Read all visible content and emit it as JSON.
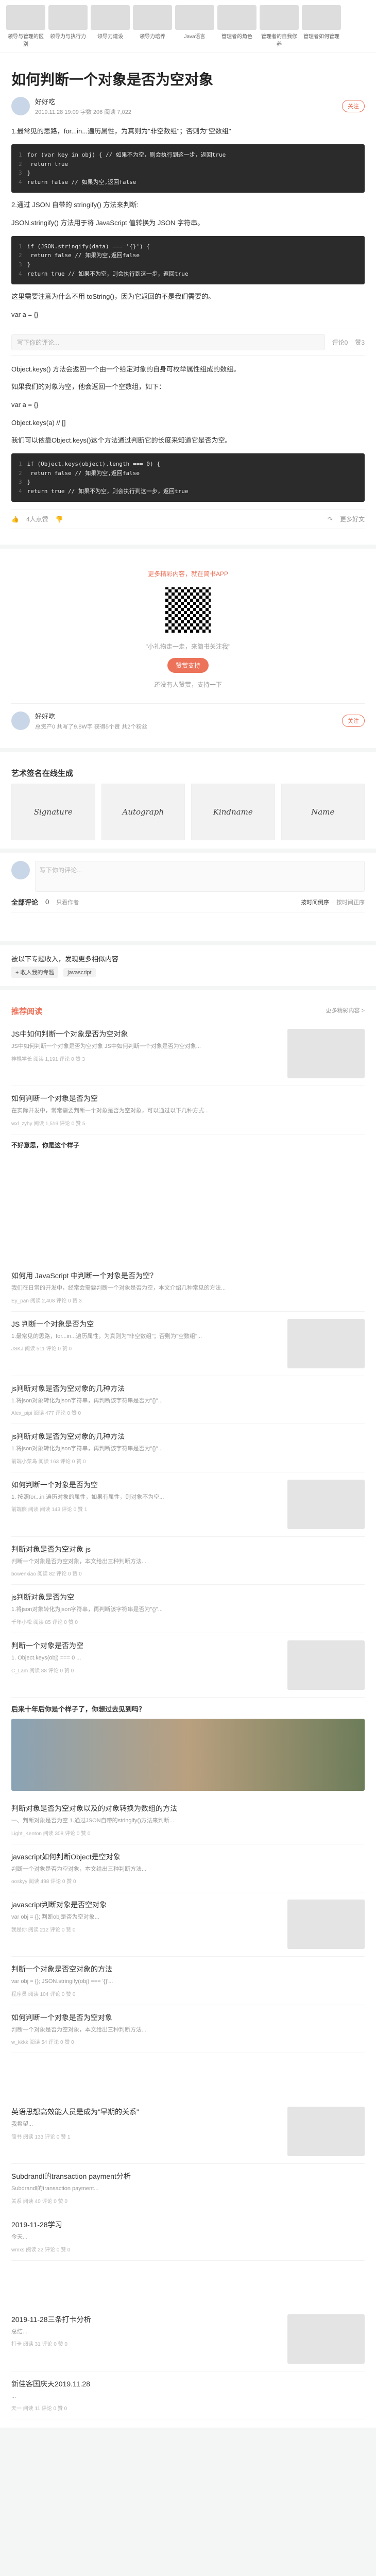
{
  "banner": {
    "items": [
      "领导与管理的区别",
      "领导力与执行力",
      "领导力建设",
      "领导力培养",
      "Java语言",
      "管理者的角色",
      "管理者的自我修养",
      "管理者如何管理"
    ]
  },
  "article": {
    "title": "如何判断一个对象是否为空对象",
    "author": "好好吃",
    "author_meta": "2019.11.28 19:09  字数 206  阅读 7,022",
    "follow": "关注",
    "paragraphs": [
      "1.最常见的思路，for...in...遍历属性，为真则为\"非空数组\"；否则为\"空数组\"",
      "2.通过 JSON 自带的 stringify() 方法来判断:",
      "JSON.stringify() 方法用于将 JavaScript 值转换为 JSON 字符串。",
      "这里需要注意为什么不用 toString()，因为它返回的不是我们需要的。",
      "var a = {}",
      "Object.keys() 方法会返回一个由一个给定对象的自身可枚举属性组成的数组。",
      "如果我们的对象为空，他会返回一个空数组，如下：",
      "var a = {}",
      "Object.keys(a) // []",
      "我们可以依靠Object.keys()这个方法通过判断它的长度来知道它是否为空。"
    ],
    "code1": [
      "for (var key in obj) { // 如果不为空，则会执行到这一步，返回true",
      "    return true",
      "}",
      "return false // 如果为空,返回false"
    ],
    "code2": [
      "if (JSON.stringify(data) === '{}') {",
      "    return false // 如果为空,返回false",
      "}",
      "return true // 如果不为空，则会执行到这一步，返回true"
    ],
    "code3": [
      "if (Object.keys(object).length === 0) {",
      "    return false // 如果为空,返回false",
      "}",
      "return true // 如果不为空，则会执行到这一步，返回true"
    ]
  },
  "toolbar": {
    "comment_placeholder": "写下你的评论...",
    "comment_label": "评论0",
    "like_label": "赞3",
    "likes_count": "4人点赞",
    "more_label": "更多好文"
  },
  "reward": {
    "hint": "更多精彩内容，就在简书APP",
    "sub1": "\"小礼物走一走，来简书关注我\"",
    "button": "赞赏支持",
    "sub2": "还没有人赞赏，支持一下"
  },
  "author_card": {
    "name": "好好吃",
    "meta": "总资产0 共写了9.8W字 获得5个赞 共2个粉丝",
    "follow": "关注"
  },
  "recommend": {
    "title": "艺术签名在线生成",
    "images": [
      "Signature",
      "Autograph",
      "Kindname",
      "Name"
    ]
  },
  "comments": {
    "placeholder": "写下你的评论...",
    "title": "全部评论",
    "count": "0",
    "only_author": "只看作者",
    "sort_new": "按时间倒序",
    "sort_old": "按时间正序"
  },
  "topics": {
    "title": "被以下专题收入，发现更多相似内容",
    "add": "+ 收入我的专题",
    "tags": [
      "javascript"
    ]
  },
  "recommended": {
    "title": "推荐阅读",
    "more": "更多精彩内容 >",
    "items": [
      {
        "title": "JS中如何判断一个对象是否为空对象",
        "desc": "JS中如何判断一个对象是否为空对象 JS中如何判断一个对象是否为空对象...",
        "meta": "神棍学长  阅读 1,191  评论 0  赞 3"
      },
      {
        "title": "如何判断一个对象是否为空",
        "desc": "在实际开发中，常常需要判断一个对象是否为空对象，可以通过以下几种方式...",
        "meta": "wxl_zyhy  阅读 1,519  评论 0  赞 5"
      },
      {
        "title": "如何用 JavaScript 中判断一个对象是否为空？",
        "desc": "我们在日常的开发中，经常会需要判断一个对象是否为空，本文介绍几种常见的方法...",
        "meta": "Ey_pan  阅读 2,408  评论 0  赞 3"
      },
      {
        "title": "JS 判断一个对象是否为空",
        "desc": "1.最常见的思路，for...in...遍历属性，为真则为\"非空数组\"；否则为\"空数组\"...",
        "meta": "JSKJ  阅读 511  评论 0  赞 0"
      },
      {
        "title": "js判断对象是否为空对象的几种方法",
        "desc": "1.将json对象转化为json字符串，再判断该字符串是否为\"{}\"...",
        "meta": "Alex_pipi  阅读 477  评论 0  赞 0"
      },
      {
        "title": "js判断对象是否为空对象的几种方法",
        "desc": "1.将json对象转化为json字符串，再判断该字符串是否为\"{}\"...",
        "meta": "前端小菜鸟  阅读 163  评论 0  赞 0"
      },
      {
        "title": "如何判断一个对象是否为空",
        "desc": "1. 按照for...in 遍历对象的属性，如果有属性，则对象不为空...",
        "meta": "前端熊 阅读  阅读 143  评论 0  赞 1"
      },
      {
        "title": "判断对象是否为空对象 js",
        "desc": "判断一个对象是否为空对象，本文给出三种判断方法...",
        "meta": "bowenxiao  阅读 82  评论 0  赞 0"
      },
      {
        "title": "js判断对象是否为空",
        "desc": "1.将json对象转化为json字符串，再判断该字符串是否为\"{}\"...",
        "meta": "千年小松  阅读 85  评论 0  赞 0"
      },
      {
        "title": "判断一个对象是否为空",
        "desc": "1. Object.keys(obj) === 0 ...",
        "meta": "C_Lam  阅读 88  评论 0  赞 0"
      },
      {
        "title": "判断对象是否为空对象以及的对象转换为数组的方法",
        "desc": "一、判断对象是否为空 1.通过JSON自带的stringify()方法来判断...",
        "meta": "Light_Kenton  阅读 308  评论 0  赞 0"
      },
      {
        "title": "javascript如何判断Object是空对象",
        "desc": "判断一个对象是否为空对象，本文给出三种判断方法...",
        "meta": "ooskyy  阅读 498  评论 0  赞 0"
      },
      {
        "title": "javascript判断对象是否空对象",
        "desc": "var obj = {}; 判断obj是否为空对象...",
        "meta": "我是你  阅读 212  评论 0  赞 0"
      },
      {
        "title": "判断一个对象是否空对象的方法",
        "desc": "var obj = {}; JSON.stringify(obj) === '{}'...",
        "meta": "程序员  阅读 104  评论 0  赞 0"
      },
      {
        "title": "如何判断一个对象是否为空对象",
        "desc": "判断一个对象是否为空对象，本文给出三种判断方法...",
        "meta": "w_kkkk  阅读 54  评论 0  赞 0"
      },
      {
        "title": "英语思想高效能人员是成为\"早期的关系\"",
        "desc": "我希望...",
        "meta": "简书  阅读 133  评论 0  赞 1"
      },
      {
        "title": "Subdrandl的transaction payment分析",
        "desc": "Subdrandl的transaction payment...",
        "meta": "关系  阅读 40  评论 0  赞 0"
      },
      {
        "title": "2019-11-28学习",
        "desc": "今天...",
        "meta": "wmxs  阅读 22  评论 0  赞 0"
      },
      {
        "title": "2019-11-28三条打卡分析",
        "desc": "总结...",
        "meta": "打卡  阅读 31  评论 0  赞 0"
      },
      {
        "title": "新佳客国庆天2019.11.28",
        "desc": "...",
        "meta": "天一  阅读 11  评论 0  赞 0"
      }
    ],
    "ad_label_1": "不好意思，你是这个样子",
    "ad_label_2": "后来十年后你是个样子了，你想过去见到吗？"
  }
}
